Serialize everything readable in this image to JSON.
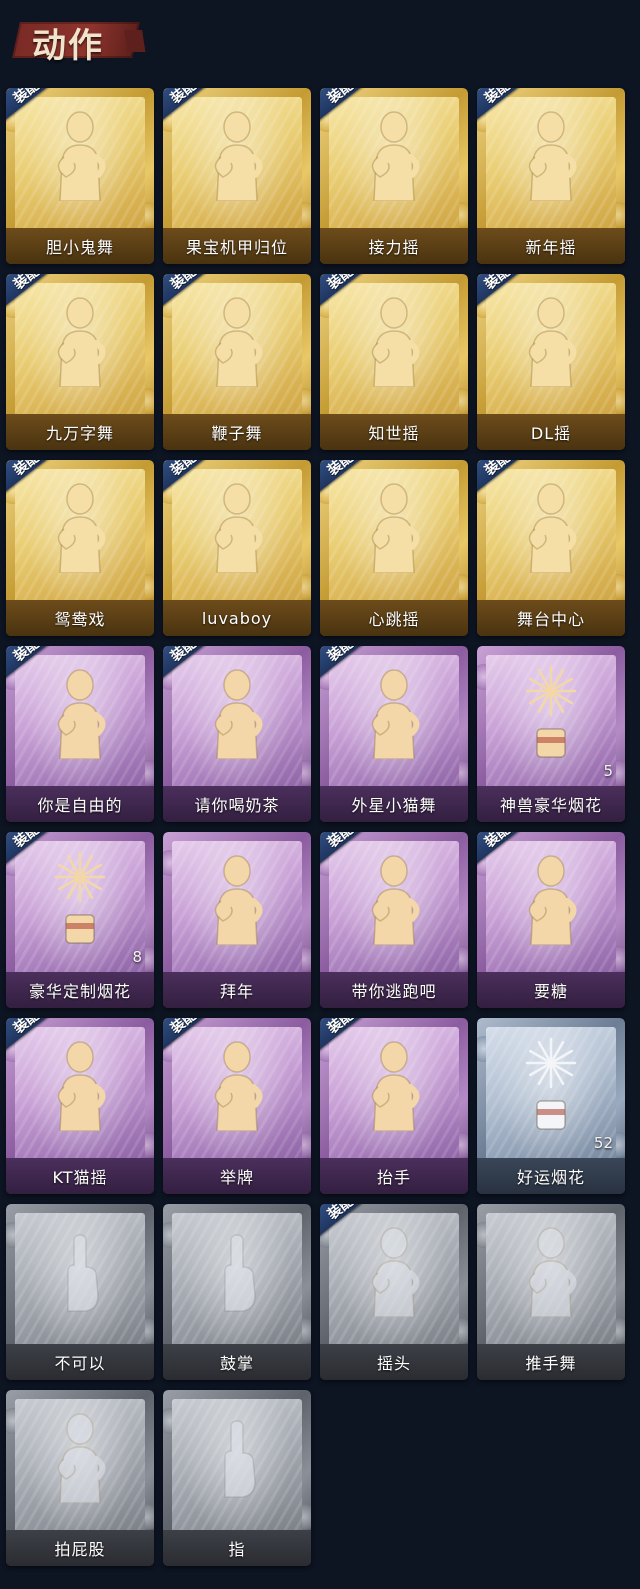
{
  "header": {
    "title": "动作"
  },
  "equip_badge_label": "装配",
  "rarity_colors": {
    "gold": "#d9b353",
    "purple": "#a379b8",
    "blue": "#8d9db3",
    "gray": "#8d929a"
  },
  "emotes": [
    {
      "name": "胆小鬼舞",
      "rarity": "gold",
      "equipped": true,
      "icon": "figure-icon",
      "count": ""
    },
    {
      "name": "果宝机甲归位",
      "rarity": "gold",
      "equipped": true,
      "icon": "figure-icon",
      "count": ""
    },
    {
      "name": "接力摇",
      "rarity": "gold",
      "equipped": true,
      "icon": "figure-icon",
      "count": ""
    },
    {
      "name": "新年摇",
      "rarity": "gold",
      "equipped": true,
      "icon": "figure-icon",
      "count": ""
    },
    {
      "name": "九万字舞",
      "rarity": "gold",
      "equipped": true,
      "icon": "figure-icon",
      "count": ""
    },
    {
      "name": "鞭子舞",
      "rarity": "gold",
      "equipped": true,
      "icon": "figure-icon",
      "count": ""
    },
    {
      "name": "知世摇",
      "rarity": "gold",
      "equipped": true,
      "icon": "figure-icon",
      "count": ""
    },
    {
      "name": "DL摇",
      "rarity": "gold",
      "equipped": true,
      "icon": "figure-icon",
      "count": ""
    },
    {
      "name": "鸳鸯戏",
      "rarity": "gold",
      "equipped": true,
      "icon": "figure-icon",
      "count": ""
    },
    {
      "name": "luvaboy",
      "rarity": "gold",
      "equipped": true,
      "icon": "figure-icon",
      "count": ""
    },
    {
      "name": "心跳摇",
      "rarity": "gold",
      "equipped": true,
      "icon": "figure-icon",
      "count": ""
    },
    {
      "name": "舞台中心",
      "rarity": "gold",
      "equipped": true,
      "icon": "figure-icon",
      "count": ""
    },
    {
      "name": "你是自由的",
      "rarity": "purple",
      "equipped": true,
      "icon": "figure-icon",
      "count": ""
    },
    {
      "name": "请你喝奶茶",
      "rarity": "purple",
      "equipped": true,
      "icon": "figure-icon",
      "count": ""
    },
    {
      "name": "外星小猫舞",
      "rarity": "purple",
      "equipped": true,
      "icon": "figure-icon",
      "count": ""
    },
    {
      "name": "神兽豪华烟花",
      "rarity": "purple",
      "equipped": false,
      "icon": "firework-icon",
      "count": "5"
    },
    {
      "name": "豪华定制烟花",
      "rarity": "purple",
      "equipped": true,
      "icon": "firework-icon",
      "count": "8"
    },
    {
      "name": "拜年",
      "rarity": "purple",
      "equipped": false,
      "icon": "figure-icon",
      "count": ""
    },
    {
      "name": "带你逃跑吧",
      "rarity": "purple",
      "equipped": true,
      "icon": "figure-icon",
      "count": ""
    },
    {
      "name": "要糖",
      "rarity": "purple",
      "equipped": true,
      "icon": "figure-icon",
      "count": ""
    },
    {
      "name": "KT猫摇",
      "rarity": "purple",
      "equipped": true,
      "icon": "figure-icon",
      "count": ""
    },
    {
      "name": "举牌",
      "rarity": "purple",
      "equipped": true,
      "icon": "figure-icon",
      "count": ""
    },
    {
      "name": "抬手",
      "rarity": "purple",
      "equipped": true,
      "icon": "figure-icon",
      "count": ""
    },
    {
      "name": "好运烟花",
      "rarity": "blue",
      "equipped": false,
      "icon": "firework-icon",
      "count": "52"
    },
    {
      "name": "不可以",
      "rarity": "gray",
      "equipped": false,
      "icon": "hand-icon",
      "count": ""
    },
    {
      "name": "鼓掌",
      "rarity": "gray",
      "equipped": false,
      "icon": "hand-icon",
      "count": ""
    },
    {
      "name": "摇头",
      "rarity": "gray",
      "equipped": true,
      "icon": "figure-icon",
      "count": ""
    },
    {
      "name": "推手舞",
      "rarity": "gray",
      "equipped": false,
      "icon": "figure-icon",
      "count": ""
    },
    {
      "name": "拍屁股",
      "rarity": "gray",
      "equipped": false,
      "icon": "figure-icon",
      "count": ""
    },
    {
      "name": "指",
      "rarity": "gray",
      "equipped": false,
      "icon": "hand-icon",
      "count": ""
    }
  ]
}
